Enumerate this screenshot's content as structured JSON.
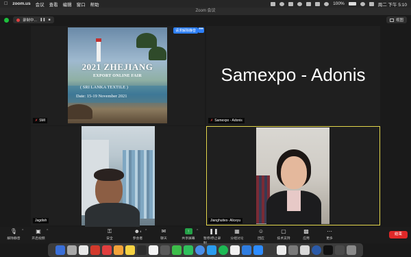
{
  "menubar": {
    "app_name": "zoom.us",
    "items": [
      "会议",
      "查看",
      "编辑",
      "窗口",
      "帮助"
    ],
    "battery": "100%",
    "datetime": "周二 下午 5:10"
  },
  "window": {
    "title": "Zoom 会议"
  },
  "recording": {
    "label": "录制中...",
    "pause": "❚❚",
    "stop": "■"
  },
  "view_button": {
    "label": "视图"
  },
  "tiles": [
    {
      "name": "SMI",
      "poster": {
        "title": "2021 ZHEJIANG",
        "subtitle": "EXPORT ONLINE FAIR",
        "textile": "( SRI LANKA TEXTILE )",
        "date": "Date: 15-19 November 2021"
      },
      "unmute_request": "请求解除静音",
      "more": "•••"
    },
    {
      "name": "Samexpo - Adonis",
      "display_name": "Samexpo - Adonis"
    },
    {
      "name": "Jagdish"
    },
    {
      "name": "Jianghuitex- Aliceyu"
    }
  ],
  "toolbar": {
    "items": [
      {
        "label": "解除静音",
        "icon": "mic-muted-icon"
      },
      {
        "label": "开启视频",
        "icon": "video-off-icon"
      },
      {
        "label": "安全",
        "icon": "shield-icon"
      },
      {
        "label": "参会者",
        "icon": "participants-icon",
        "count": "4"
      },
      {
        "label": "聊天",
        "icon": "chat-icon"
      },
      {
        "label": "共享屏幕",
        "icon": "share-screen-icon"
      },
      {
        "label": "暂停/停止录制",
        "icon": "record-icon"
      },
      {
        "label": "分组讨论",
        "icon": "breakout-icon"
      },
      {
        "label": "回应",
        "icon": "reaction-icon"
      },
      {
        "label": "技术支持",
        "icon": "support-icon"
      },
      {
        "label": "应用",
        "icon": "apps-icon"
      },
      {
        "label": "更多",
        "icon": "more-icon"
      }
    ],
    "end_label": "结束"
  },
  "colors": {
    "active_speaker": "#e5d84d",
    "end": "#e02828",
    "share": "#24a148",
    "accent": "#2d7ff9"
  }
}
